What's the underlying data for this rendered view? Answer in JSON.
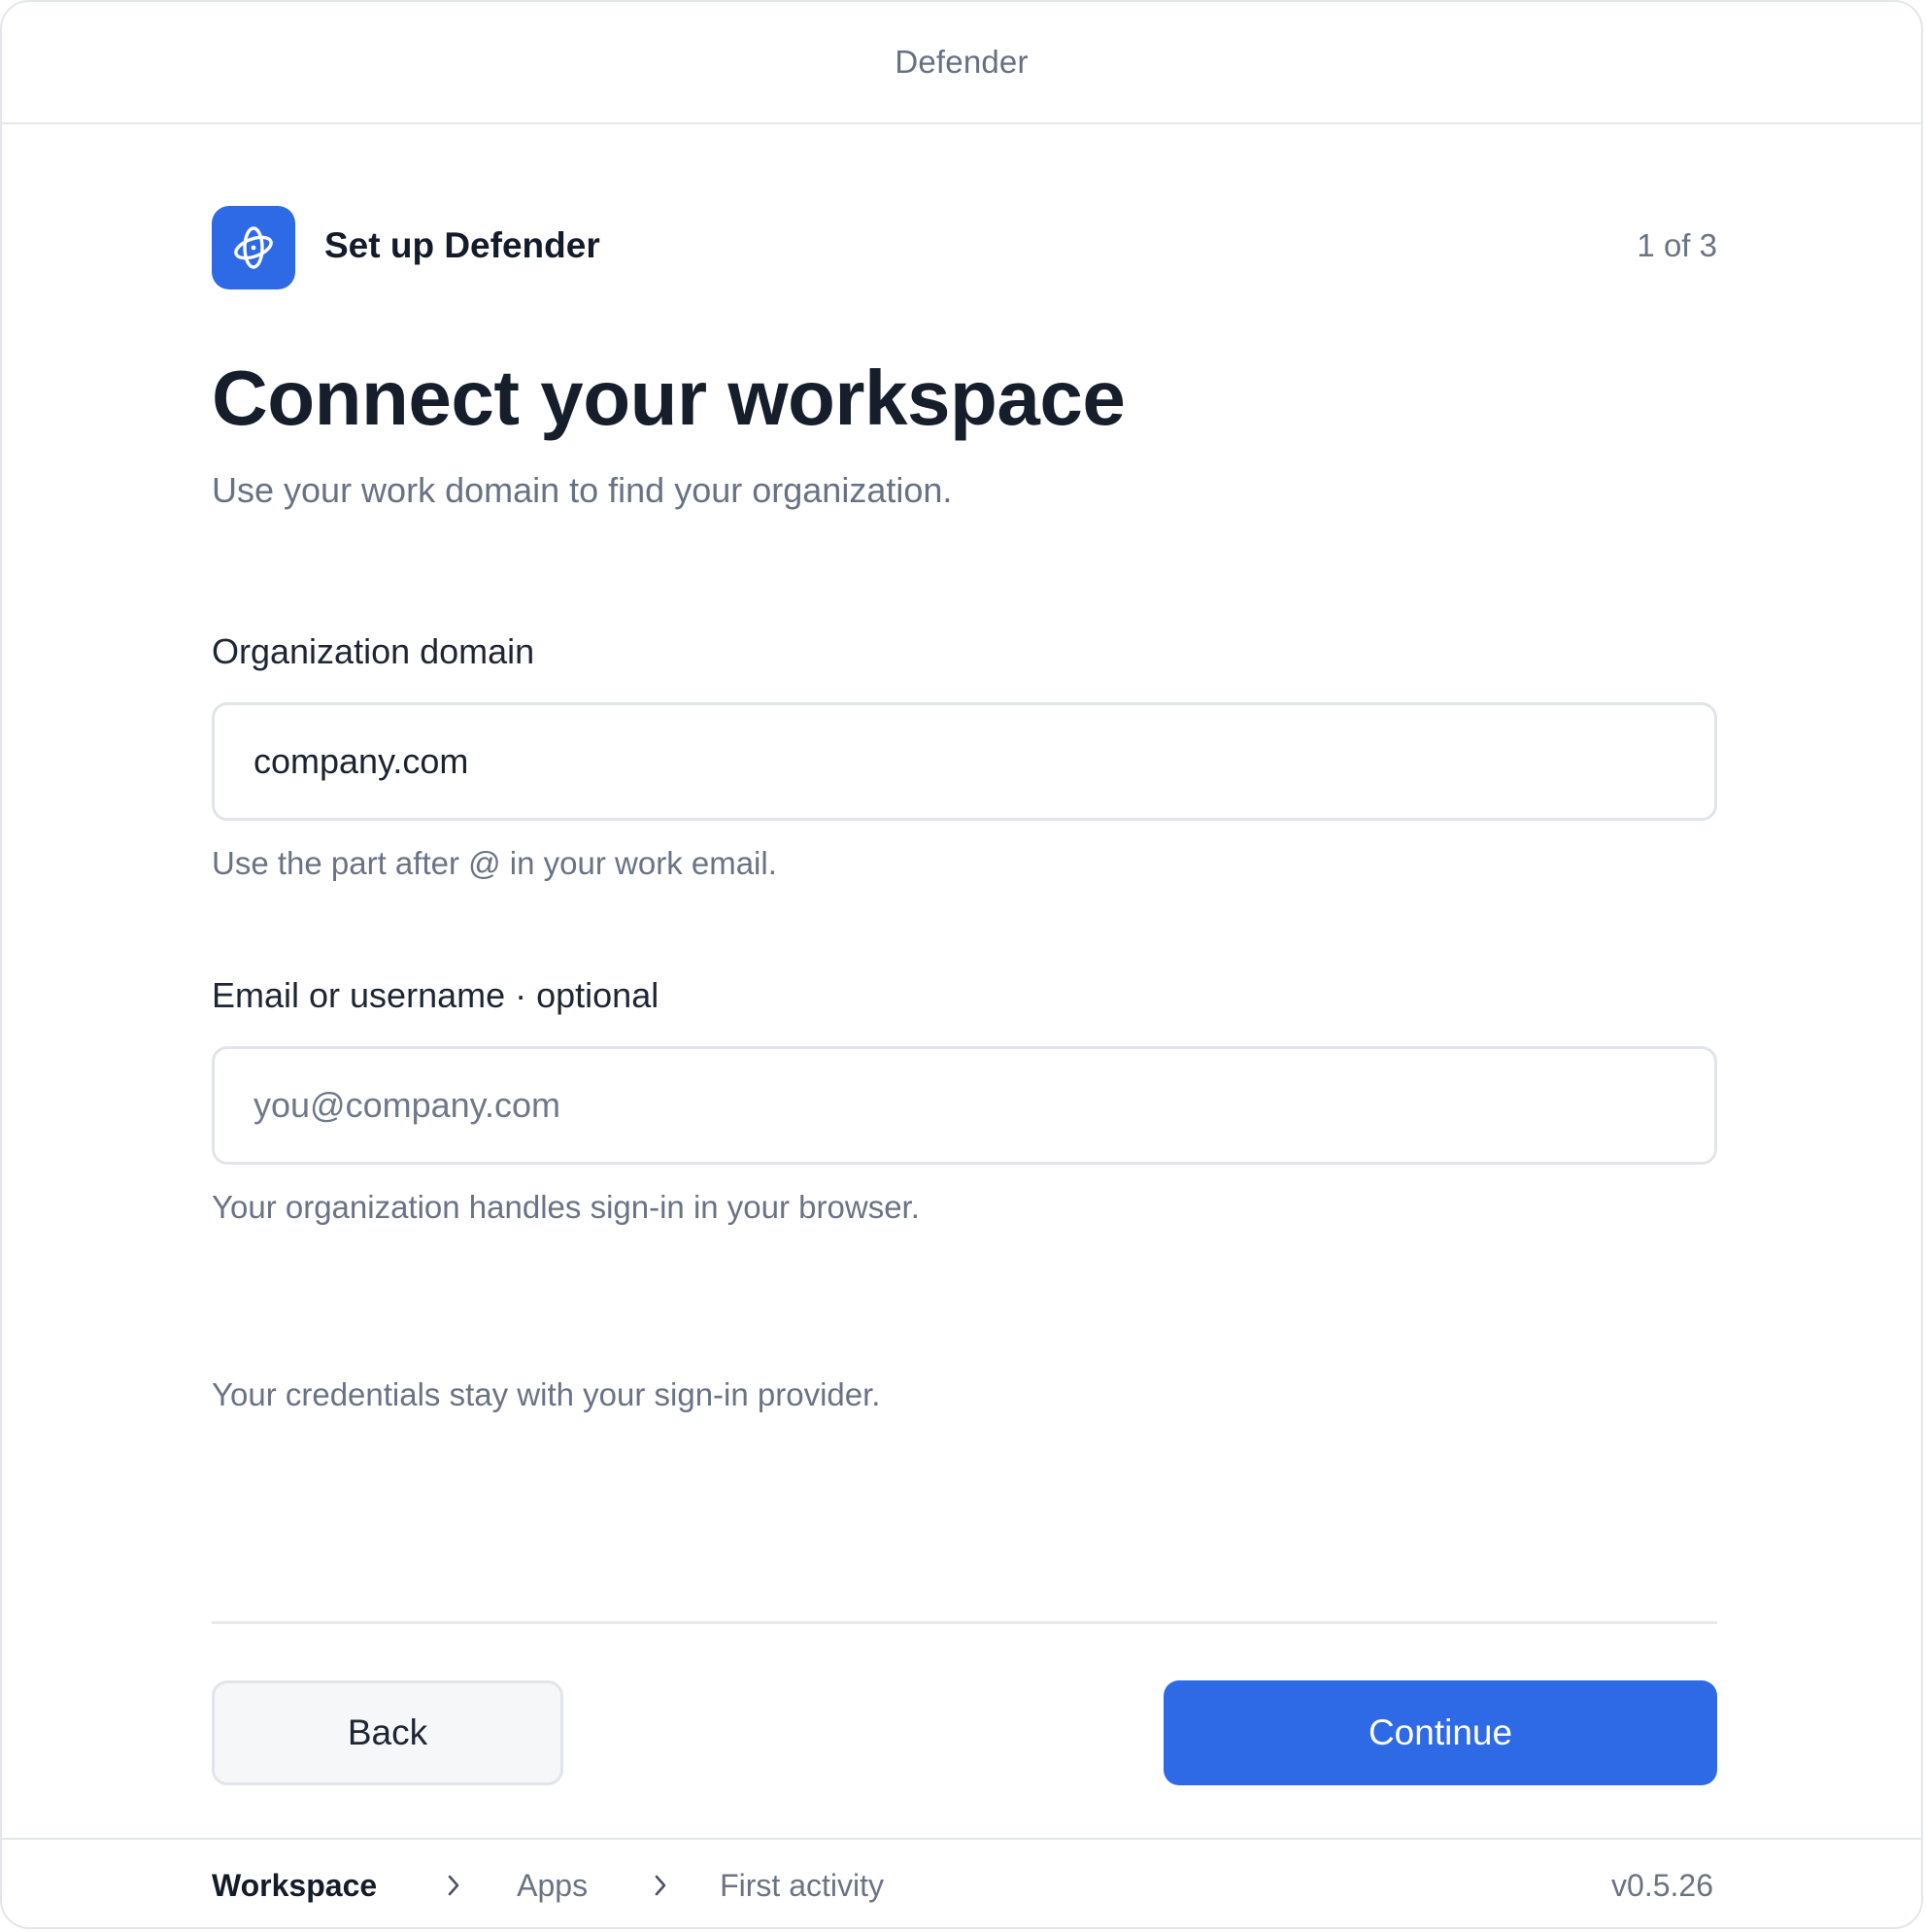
{
  "window": {
    "title": "Defender"
  },
  "header": {
    "app_icon": "orbit-logo-icon",
    "app_title": "Set up Defender",
    "step": "1 of 3"
  },
  "main": {
    "title": "Connect your workspace",
    "subtitle": "Use your work domain to find your organization.",
    "fields": [
      {
        "label": "Organization domain",
        "value": "company.com",
        "placeholder": "",
        "helper": "Use the part after @ in your work email."
      },
      {
        "label": "Email or username · optional",
        "value": "",
        "placeholder": "you@company.com",
        "helper": "Your organization handles sign-in in your browser."
      }
    ],
    "note": "Your credentials stay with your sign-in provider."
  },
  "actions": {
    "back_label": "Back",
    "continue_label": "Continue"
  },
  "footer": {
    "breadcrumb": [
      "Workspace",
      "Apps",
      "First activity"
    ],
    "separator_icon": "chevron-right-icon",
    "version": "v0.5.26"
  },
  "colors": {
    "accent": "#2f6ae6",
    "border": "#e1e5ea",
    "muted_text": "#6b7383",
    "heading_text": "#161d2b"
  }
}
